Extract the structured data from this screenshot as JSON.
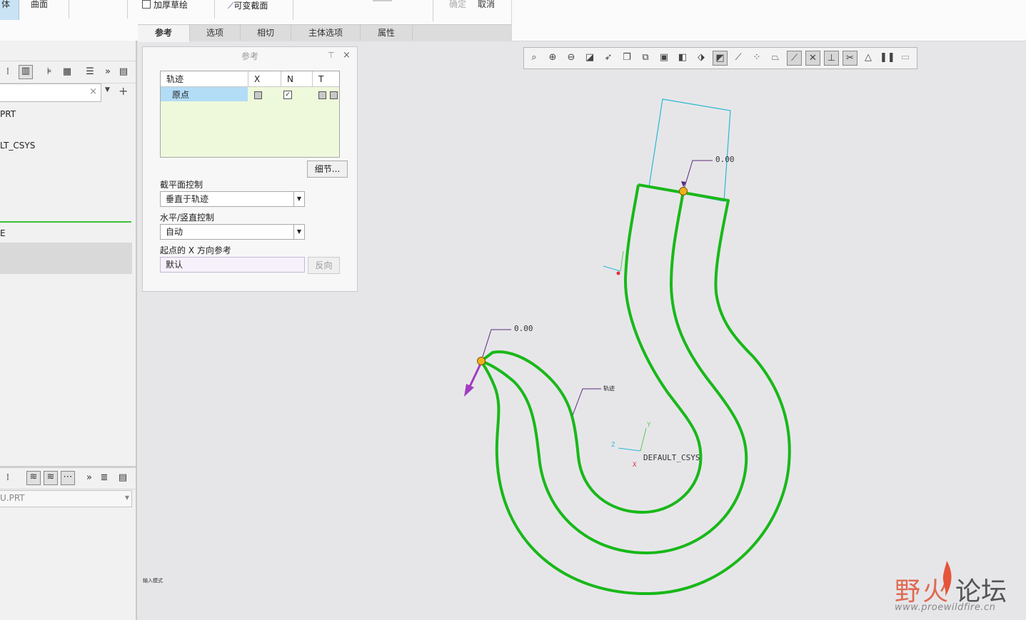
{
  "ribbon": {
    "left_tab_1": "体",
    "left_tab_2": "曲面",
    "thicken_sketch": "加厚草绘",
    "variable_section": "可变截面",
    "ok": "确定",
    "cancel": "取消",
    "tabs": [
      "参考",
      "选项",
      "相切",
      "主体选项",
      "属性"
    ]
  },
  "left_panel": {
    "tree_items": [
      "PRT",
      "LT_CSYS",
      "E"
    ],
    "bottom_model": "U.PRT"
  },
  "ref_panel": {
    "title": "参考",
    "table_headers": [
      "轨迹",
      "X",
      "N",
      "T"
    ],
    "row_label": "原点",
    "details_button": "细节...",
    "section_control_label": "截平面控制",
    "section_control_value": "垂直于轨迹",
    "hv_control_label": "水平/竖直控制",
    "hv_control_value": "自动",
    "x_dir_label": "起点的 X 方向参考",
    "x_dir_value": "默认",
    "flip_button": "反向"
  },
  "canvas": {
    "dim_top": "0.00",
    "dim_left": "0.00",
    "note_label": "轨迹",
    "csys_label": "DEFAULT_CSYS",
    "axis_x": "X",
    "axis_y": "Y",
    "axis_z": "Z",
    "status_text": "输入模式",
    "colors": {
      "trajectory": "#19b819",
      "section": "#2bb7d2",
      "start_arrow": "#a23cc0",
      "point": "#f2b01e"
    }
  },
  "watermark": {
    "logo_cn_1": "野",
    "logo_cn_2": "火",
    "logo_cn_3": "论坛",
    "url": "www.proewildfire.cn"
  }
}
